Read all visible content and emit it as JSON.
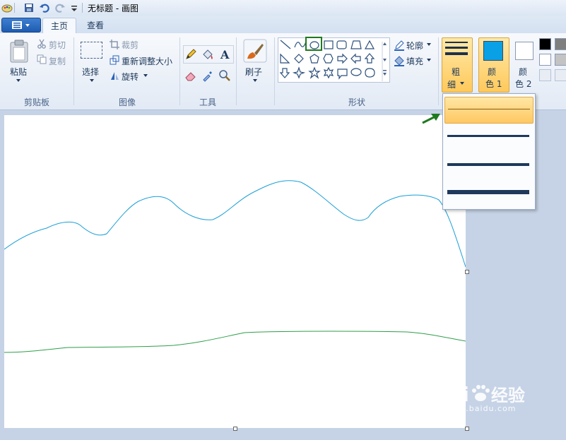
{
  "window": {
    "title": "无标题 - 画图"
  },
  "tabs": [
    {
      "label": "主页",
      "active": true
    },
    {
      "label": "查看",
      "active": false
    }
  ],
  "clipboard": {
    "paste_label": "粘贴",
    "cut_label": "剪切",
    "copy_label": "复制",
    "group_label": "剪贴板"
  },
  "image": {
    "select_label": "选择",
    "crop_label": "裁剪",
    "resize_label": "重新调整大小",
    "rotate_label": "旋转",
    "group_label": "图像"
  },
  "tools": {
    "group_label": "工具",
    "icons": [
      "pencil-icon",
      "fill-icon",
      "text-icon",
      "eraser-icon",
      "color-picker-icon",
      "magnifier-icon"
    ]
  },
  "brushes": {
    "label": "刷子"
  },
  "shapes": {
    "group_label": "形状",
    "outline_label": "轮廓",
    "fill_label": "填充",
    "selected_shape": "oval"
  },
  "size": {
    "label_top": "粗",
    "label_bottom": "细"
  },
  "color1": {
    "label_top": "颜",
    "label_bottom": "色 1",
    "value": "#0aa0e6"
  },
  "color2": {
    "label_top": "颜",
    "label_bottom": "色 2",
    "value": "#ffffff"
  },
  "palette": [
    "#000000",
    "#7f7f7f",
    "#ffffff",
    "#c3c3c3"
  ],
  "dropdown": {
    "items": [
      {
        "thickness": 1,
        "selected": true
      },
      {
        "thickness": 3,
        "selected": false
      },
      {
        "thickness": 5,
        "selected": false
      },
      {
        "thickness": 8,
        "selected": false
      }
    ]
  },
  "drawing": {
    "blue_color": "#1a9fd6",
    "green_color": "#2e9e4a"
  },
  "watermark": {
    "brand": "Bai",
    "brand2": "经验",
    "url": "jingyan.baidu.com"
  },
  "accent_colors": {
    "highlight_border": "#1f7a1f",
    "arrow": "#1f7a1f"
  }
}
